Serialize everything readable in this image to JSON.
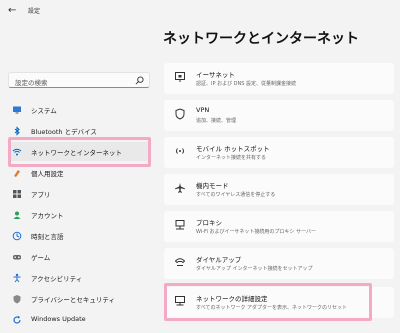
{
  "app": {
    "title": "設定",
    "back_glyph": "←"
  },
  "search": {
    "placeholder": "設定の検索"
  },
  "page": {
    "title": "ネットワークとインターネット"
  },
  "nav": [
    {
      "label": "システム",
      "icon": "system-icon"
    },
    {
      "label": "Bluetooth とデバイス",
      "icon": "bluetooth-icon"
    },
    {
      "label": "ネットワークとインターネット",
      "icon": "wifi-icon",
      "active": true
    },
    {
      "label": "個人用設定",
      "icon": "personalization-icon"
    },
    {
      "label": "アプリ",
      "icon": "apps-icon"
    },
    {
      "label": "アカウント",
      "icon": "account-icon"
    },
    {
      "label": "時刻と言語",
      "icon": "time-language-icon"
    },
    {
      "label": "ゲーム",
      "icon": "gaming-icon"
    },
    {
      "label": "アクセシビリティ",
      "icon": "accessibility-icon"
    },
    {
      "label": "プライバシーとセキュリティ",
      "icon": "privacy-icon"
    },
    {
      "label": "Windows Update",
      "icon": "windows-update-icon"
    }
  ],
  "cards": [
    {
      "title": "イーサネット",
      "subtitle": "認証、IP および DNS 設定、従量制課金接続",
      "icon": "ethernet-icon"
    },
    {
      "title": "VPN",
      "subtitle": "追加、接続、管理",
      "icon": "vpn-icon"
    },
    {
      "title": "モバイル ホットスポット",
      "subtitle": "インターネット接続を共有する",
      "icon": "hotspot-icon"
    },
    {
      "title": "機内モード",
      "subtitle": "すべてのワイヤレス通信を停止する",
      "icon": "airplane-icon"
    },
    {
      "title": "プロキシ",
      "subtitle": "Wi-Fi およびイーサネット接続用のプロキシ サーバー",
      "icon": "proxy-icon"
    },
    {
      "title": "ダイヤルアップ",
      "subtitle": "ダイヤルアップ インターネット接続をセットアップ",
      "icon": "dialup-icon"
    },
    {
      "title": "ネットワークの詳細設定",
      "subtitle": "すべてのネットワーク アダプターを表示、ネットワークのリセット",
      "icon": "advanced-network-icon"
    }
  ],
  "colors": {
    "accent": "#0067c0",
    "highlight": "#f4a9c6",
    "background": "#f3f3f3",
    "card": "#fbfbfb"
  }
}
